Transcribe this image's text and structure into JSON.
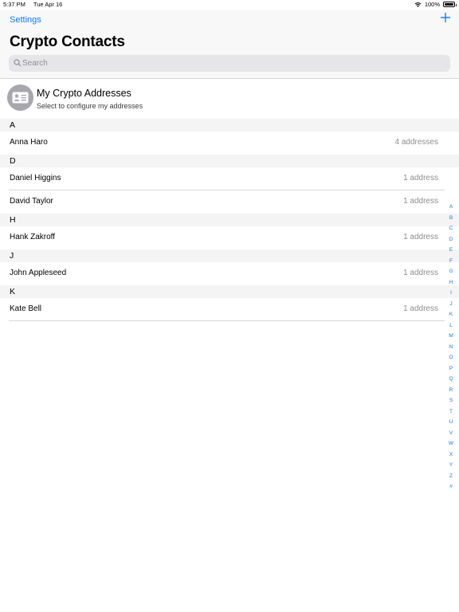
{
  "status_bar": {
    "time": "5:37 PM",
    "date": "Tue Apr 16",
    "battery": "100%",
    "battery_level": 1.0
  },
  "nav": {
    "back_label": "Settings",
    "add_icon": "plus-icon"
  },
  "title": "Crypto Contacts",
  "search": {
    "placeholder": "Search",
    "value": ""
  },
  "my_addresses": {
    "title": "My Crypto Addresses",
    "subtitle": "Select to configure my addresses",
    "icon": "contact-card-icon"
  },
  "sections": [
    {
      "letter": "A",
      "contacts": [
        {
          "name": "Anna Haro",
          "count": "4 addresses"
        }
      ]
    },
    {
      "letter": "D",
      "contacts": [
        {
          "name": "Daniel Higgins",
          "count": "1 address"
        },
        {
          "name": "David Taylor",
          "count": "1 address"
        }
      ]
    },
    {
      "letter": "H",
      "contacts": [
        {
          "name": "Hank Zakroff",
          "count": "1 address"
        }
      ]
    },
    {
      "letter": "J",
      "contacts": [
        {
          "name": "John Appleseed",
          "count": "1 address"
        }
      ]
    },
    {
      "letter": "K",
      "contacts": [
        {
          "name": "Kate Bell",
          "count": "1 address"
        }
      ]
    }
  ],
  "index_letters": [
    "A",
    "B",
    "C",
    "D",
    "E",
    "F",
    "G",
    "H",
    "I",
    "J",
    "K",
    "L",
    "M",
    "N",
    "O",
    "P",
    "Q",
    "R",
    "S",
    "T",
    "U",
    "V",
    "W",
    "X",
    "Y",
    "Z",
    "#"
  ],
  "colors": {
    "accent": "#0a7aff",
    "secondary_text": "#8e8e93",
    "section_bg": "#f4f4f5",
    "avatar_bg": "#a7a7ac"
  }
}
